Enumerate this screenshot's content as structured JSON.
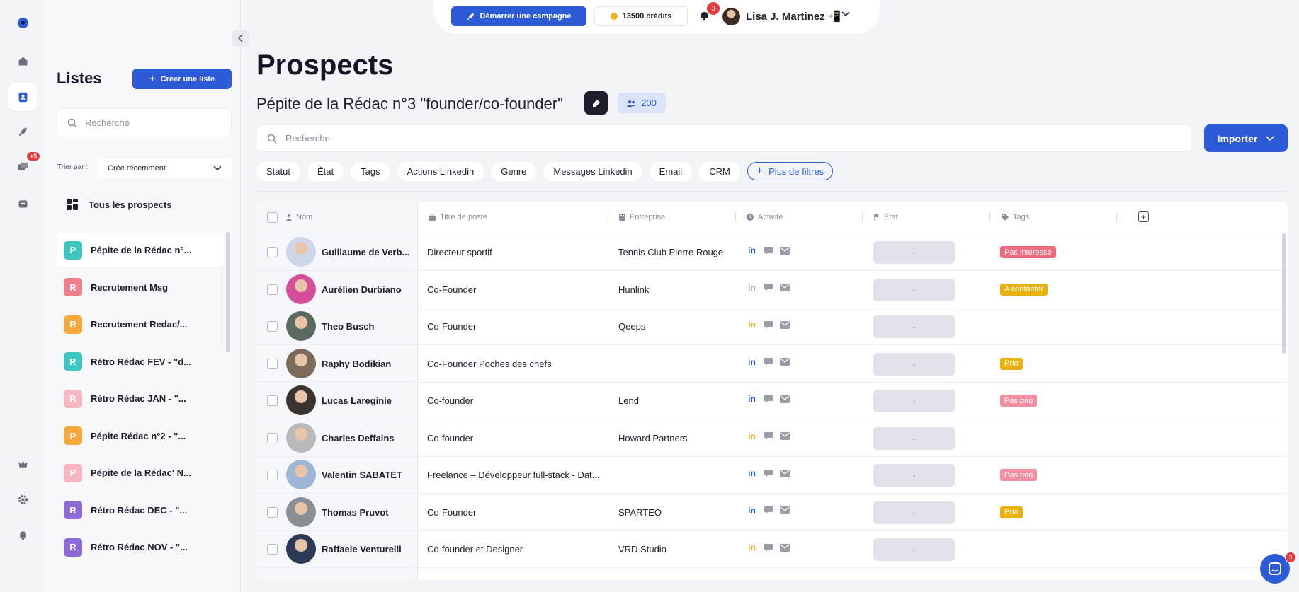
{
  "rail": {
    "notif_badge": "+5"
  },
  "lists_panel": {
    "title": "Listes",
    "create_label": "Créer une liste",
    "search_placeholder": "Recherche",
    "sort_label": "Trier par :",
    "sort_value": "Créé récemment",
    "all_prospects": "Tous les prospects",
    "items": [
      {
        "letter": "P",
        "name": "Pépite de la Rédac n°...",
        "color": "#3dc7c0",
        "selected": true
      },
      {
        "letter": "R",
        "name": "Recrutement Msg",
        "color": "#f07f8e"
      },
      {
        "letter": "R",
        "name": "Recrutement Redac/...",
        "color": "#f5a93c"
      },
      {
        "letter": "R",
        "name": "Rétro Rédac FEV - \"d...",
        "color": "#3dc7c0"
      },
      {
        "letter": "R",
        "name": "Rétro Rédac JAN - \"...",
        "color": "#f8b6c2"
      },
      {
        "letter": "P",
        "name": "Pépite Rédac n°2 - \"...",
        "color": "#f5a93c"
      },
      {
        "letter": "P",
        "name": "Pépite de la Rédac' N...",
        "color": "#f8b6c2"
      },
      {
        "letter": "R",
        "name": "Rétro Rédac DEC - \"...",
        "color": "#8e6ad8"
      },
      {
        "letter": "R",
        "name": "Rétro Rédac NOV - \"...",
        "color": "#8e6ad8"
      }
    ]
  },
  "topbar": {
    "campaign_label": "Démarrer une campagne",
    "credits_label": "13500 crédits",
    "notif_count": "3",
    "user_name": "Lisa J. Martinez 📲"
  },
  "main": {
    "page_title": "Prospects",
    "list_title": "Pépite de la Rédac n°3 \"founder/co-founder\"",
    "count": "200",
    "search_placeholder": "Recherche",
    "import_label": "Importer",
    "filters": [
      "Statut",
      "État",
      "Tags",
      "Actions Linkedin",
      "Genre",
      "Messages Linkedin",
      "Email",
      "CRM"
    ],
    "more_filters": "Plus de filtres"
  },
  "table": {
    "columns": {
      "name": "Nom",
      "job": "Titre de poste",
      "company": "Entreprise",
      "activity": "Activité",
      "state": "État",
      "tags": "Tags"
    },
    "rows": [
      {
        "name": "Guillaume de Verb...",
        "job": "Directeur sportif",
        "company": "Tennis Club Pierre Rouge",
        "li_color": "#1f56c8",
        "state": "-",
        "tag": "Pas intéressé",
        "tag_color": "#f06a7d",
        "avatar": "#cfd6ea"
      },
      {
        "name": "Aurélien Durbiano",
        "job": "Co-Founder",
        "company": "Hunlink",
        "li_color": "#a3a6b1",
        "state": "-",
        "tag": "A contacter",
        "tag_color": "#e8b10e",
        "avatar": "#d44f9a"
      },
      {
        "name": "Theo Busch",
        "job": "Co-Founder",
        "company": "Qeeps",
        "li_color": "#f0a21c",
        "state": "-",
        "tag": "",
        "tag_color": "",
        "avatar": "#5b6a5f"
      },
      {
        "name": "Raphy Bodikian",
        "job": "Co-Founder Poches des chefs",
        "company": "",
        "li_color": "#1f56c8",
        "state": "-",
        "tag": "Prio",
        "tag_color": "#e8b10e",
        "avatar": "#7c6b5a"
      },
      {
        "name": "Lucas Lareginie",
        "job": "Co-founder",
        "company": "Lend",
        "li_color": "#1f56c8",
        "state": "-",
        "tag": "Pas prio",
        "tag_color": "#f28fa0",
        "avatar": "#3b3330"
      },
      {
        "name": "Charles Deffains",
        "job": "Co-founder",
        "company": "Howard Partners",
        "li_color": "#f0a21c",
        "state": "-",
        "tag": "",
        "tag_color": "",
        "avatar": "#b9b9b9"
      },
      {
        "name": "Valentin SABATET",
        "job": "Freelance – Développeur full-stack - Dat...",
        "company": "",
        "li_color": "#1f56c8",
        "state": "-",
        "tag": "Pas prio",
        "tag_color": "#f28fa0",
        "avatar": "#9fb7d4"
      },
      {
        "name": "Thomas Pruvot",
        "job": "Co-Founder",
        "company": "SPARTEO",
        "li_color": "#1f56c8",
        "state": "-",
        "tag": "Prio",
        "tag_color": "#e8b10e",
        "avatar": "#8a8f96"
      },
      {
        "name": "Raffaele Venturelli",
        "job": "Co-founder et Designer",
        "company": "VRD Studio",
        "li_color": "#f0a21c",
        "state": "-",
        "tag": "",
        "tag_color": "",
        "avatar": "#2c3a55"
      }
    ]
  },
  "chat": {
    "badge": "3"
  }
}
